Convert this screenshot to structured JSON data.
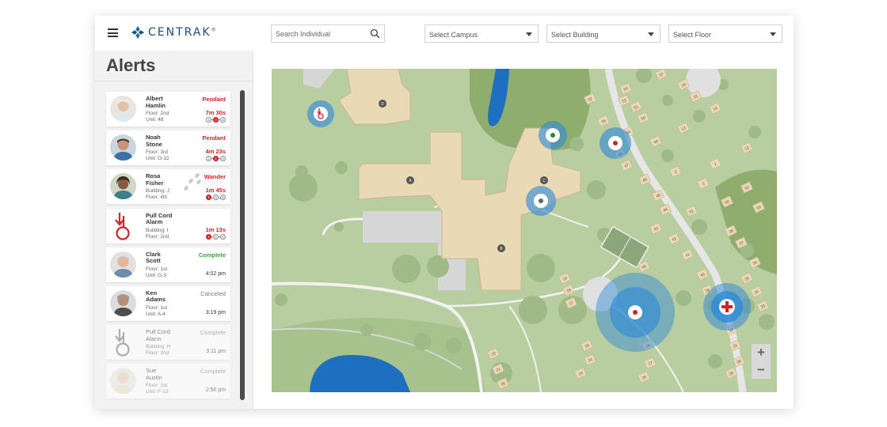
{
  "header": {
    "brand": "CENTRAK",
    "brand_mark": "®",
    "search": {
      "placeholder": "Search Individual"
    },
    "selects": {
      "campus": "Select Campus",
      "building": "Select Building",
      "floor": "Select Floor"
    }
  },
  "sidebar": {
    "title": "Alerts",
    "alerts": [
      {
        "name": "Albert\nHamlin",
        "location": "Floor: 2nd\nUnit: 48",
        "status": "Pendant",
        "time": "7m 30s",
        "steps": [
          "1",
          "2",
          "3"
        ]
      },
      {
        "name": "Noah\nStone",
        "location": "Floor: 3rd\nUnit: O-32",
        "status": "Pendant",
        "time": "4m 23s",
        "steps": [
          "1",
          "2",
          "3"
        ]
      },
      {
        "name": "Rosa\nFisher",
        "location": "Building: J\nFloor: 4th",
        "status": "Wander",
        "time": "1m 45s",
        "steps": [
          "1",
          "2",
          "3"
        ]
      },
      {
        "name": "Pull Cord\nAlarm",
        "location": "Building: I\nFloor: 2nd",
        "status": "",
        "time": "1m 13s",
        "steps": [
          "1",
          "2",
          "3"
        ]
      },
      {
        "name": "Clark\nScott",
        "location": "Floor: 1st\nUnit: G-3",
        "status": "Complete",
        "time": "4:02 pm"
      },
      {
        "name": "Ken\nAdams",
        "location": "Floor: 1st\nUnit: A-4",
        "status": "Canceled",
        "time": "3:19 pm"
      },
      {
        "name": "Pull Cord\nAlarm",
        "location": "Building: H\nFloor: 2nd",
        "status": "Complete",
        "time": "3:11 pm"
      },
      {
        "name": "Sue\nAustin",
        "location": "Floor: 1st\nUnit: F-13",
        "status": "Complete",
        "time": "2:56 pm"
      }
    ]
  },
  "map": {
    "building_labels": [
      "A",
      "B",
      "C",
      "D"
    ],
    "cottage_labels": [
      "57",
      "54",
      "53",
      "52",
      "51",
      "50",
      "56",
      "49",
      "48",
      "47",
      "46",
      "45",
      "44",
      "43",
      "42",
      "41",
      "40",
      "39",
      "38",
      "37",
      "36",
      "35",
      "34",
      "33",
      "32",
      "31",
      "30",
      "29",
      "28",
      "27",
      "26",
      "25",
      "24",
      "23",
      "22",
      "21",
      "20",
      "19",
      "18",
      "17",
      "16",
      "15",
      "14",
      "13",
      "12",
      "1",
      "2",
      "3",
      "60",
      "61",
      "62",
      "63",
      "64",
      "65"
    ],
    "zoom_in": "+",
    "zoom_out": "−"
  },
  "colors": {
    "alert_red": "#d0232a",
    "complete_green": "#3aa53a",
    "beacon_blue": "#2b88d8",
    "building_tan": "#ead9b5",
    "grass": "#b8cda0"
  }
}
